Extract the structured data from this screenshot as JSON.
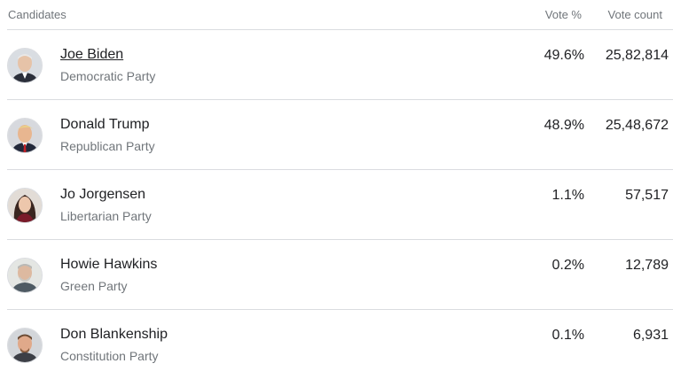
{
  "header": {
    "candidates_label": "Candidates",
    "vote_pct_label": "Vote %",
    "vote_count_label": "Vote count"
  },
  "candidates": [
    {
      "name": "Joe Biden",
      "party": "Democratic Party",
      "vote_pct": "49.6%",
      "vote_count": "25,82,814",
      "avatar_icon": "candidate-photo"
    },
    {
      "name": "Donald Trump",
      "party": "Republican Party",
      "vote_pct": "48.9%",
      "vote_count": "25,48,672",
      "avatar_icon": "candidate-photo"
    },
    {
      "name": "Jo Jorgensen",
      "party": "Libertarian Party",
      "vote_pct": "1.1%",
      "vote_count": "57,517",
      "avatar_icon": "candidate-photo"
    },
    {
      "name": "Howie Hawkins",
      "party": "Green Party",
      "vote_pct": "0.2%",
      "vote_count": "12,789",
      "avatar_icon": "candidate-photo"
    },
    {
      "name": "Don Blankenship",
      "party": "Constitution Party",
      "vote_pct": "0.1%",
      "vote_count": "6,931",
      "avatar_icon": "candidate-photo"
    }
  ]
}
